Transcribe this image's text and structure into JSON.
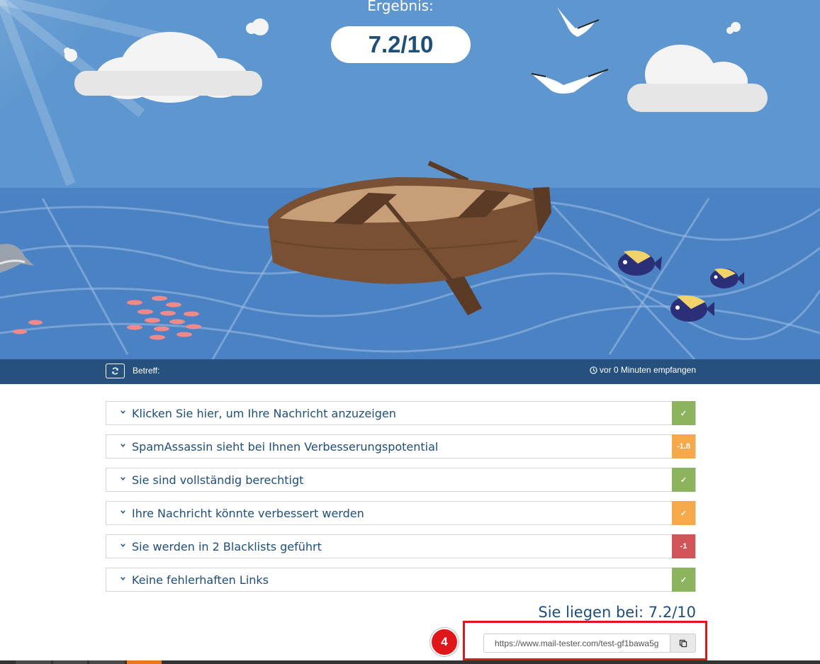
{
  "hero": {
    "result_label": "Ergebnis:",
    "score": "7.2/10"
  },
  "info_bar": {
    "subject_label": "Betreff:",
    "received_text": "vor 0 Minuten empfangen"
  },
  "colors": {
    "ok": "#8cb35d",
    "warning": "#f5a94a",
    "danger": "#d35458",
    "brand_text": "#1f4e79",
    "bar": "#26517e",
    "highlight": "#e0161b"
  },
  "results": [
    {
      "label": "Klicken Sie hier, um Ihre Nachricht anzuzeigen",
      "badge": "✓",
      "status": "ok"
    },
    {
      "label": "SpamAssassin sieht bei Ihnen Verbesserungspotential",
      "badge": "-1.8",
      "status": "warning"
    },
    {
      "label": "Sie sind vollständig berechtigt",
      "badge": "✓",
      "status": "ok"
    },
    {
      "label": "Ihre Nachricht könnte verbessert werden",
      "badge": "✓",
      "status": "warning"
    },
    {
      "label": "Sie werden in 2 Blacklists geführt",
      "badge": "-1",
      "status": "danger"
    },
    {
      "label": "Keine fehlerhaften Links",
      "badge": "✓",
      "status": "ok"
    }
  ],
  "summary": {
    "total_text": "Sie liegen bei: 7.2/10"
  },
  "share": {
    "url": "https://www.mail-tester.com/test-gf1bawa5g",
    "step_number": "4"
  }
}
